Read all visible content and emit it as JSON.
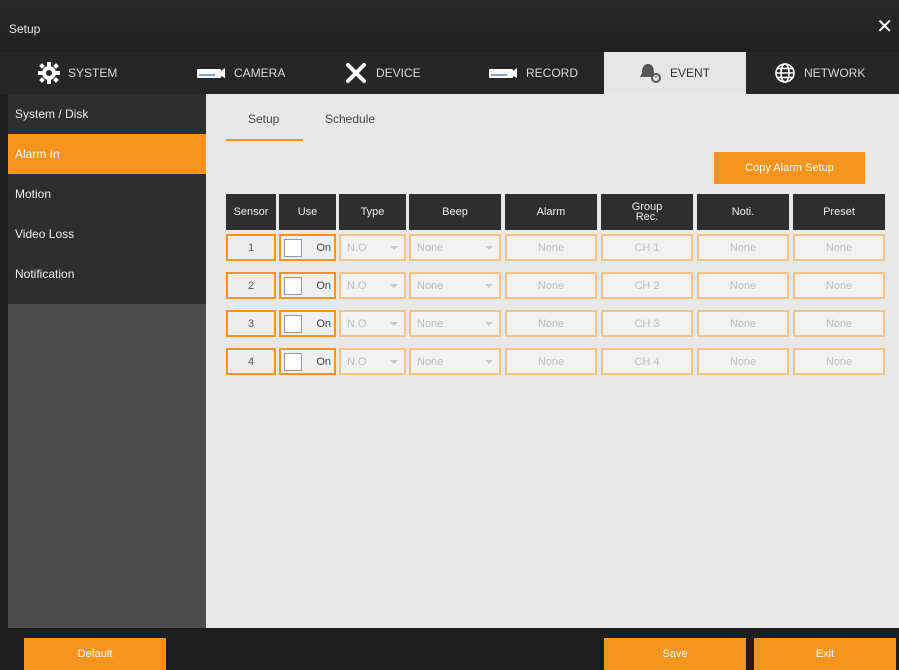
{
  "window": {
    "title": "Setup",
    "close_glyph": "✕"
  },
  "tabs": [
    {
      "label": "SYSTEM",
      "icon": "gear-icon"
    },
    {
      "label": "CAMERA",
      "icon": "camera-icon"
    },
    {
      "label": "DEVICE",
      "icon": "tools-icon"
    },
    {
      "label": "RECORD",
      "icon": "record-icon"
    },
    {
      "label": "EVENT",
      "icon": "bell-icon",
      "active": true
    },
    {
      "label": "NETWORK",
      "icon": "globe-icon"
    }
  ],
  "sidebar": {
    "items": [
      {
        "label": "System / Disk"
      },
      {
        "label": "Alarm In",
        "active": true
      },
      {
        "label": "Motion"
      },
      {
        "label": "Video Loss"
      },
      {
        "label": "Notification"
      }
    ]
  },
  "subtabs": {
    "setup": "Setup",
    "schedule": "Schedule"
  },
  "copy_button": "Copy Alarm Setup",
  "table": {
    "headers": {
      "sensor": "Sensor",
      "use": "Use",
      "type": "Type",
      "beep": "Beep",
      "alarm": "Alarm",
      "group_line1": "Group",
      "group_line2": "Rec.",
      "noti": "Noti.",
      "preset": "Preset"
    },
    "rows": [
      {
        "sensor": "1",
        "use": "On",
        "type": "N.O",
        "beep": "None",
        "alarm": "None",
        "group": "CH 1",
        "noti": "None",
        "preset": "None"
      },
      {
        "sensor": "2",
        "use": "On",
        "type": "N.O",
        "beep": "None",
        "alarm": "None",
        "group": "CH 2",
        "noti": "None",
        "preset": "None"
      },
      {
        "sensor": "3",
        "use": "On",
        "type": "N.O",
        "beep": "None",
        "alarm": "None",
        "group": "CH 3",
        "noti": "None",
        "preset": "None"
      },
      {
        "sensor": "4",
        "use": "On",
        "type": "N.O",
        "beep": "None",
        "alarm": "None",
        "group": "CH 4",
        "noti": "None",
        "preset": "None"
      }
    ]
  },
  "buttons": {
    "default": "Default",
    "save": "Save",
    "exit": "Exit"
  },
  "colors": {
    "accent": "#f7941d",
    "dark": "#2e2e2e",
    "panel": "#e8e8e8"
  }
}
